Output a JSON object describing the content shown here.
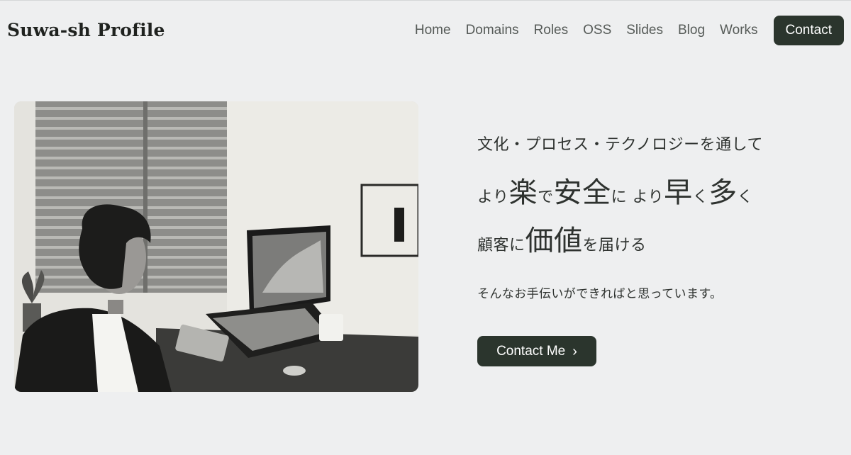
{
  "brand": {
    "title": "Suwa-sh Profile"
  },
  "nav": {
    "items": [
      {
        "label": "Home"
      },
      {
        "label": "Domains"
      },
      {
        "label": "Roles"
      },
      {
        "label": "OSS"
      },
      {
        "label": "Slides"
      },
      {
        "label": "Blog"
      },
      {
        "label": "Works"
      }
    ],
    "contact_label": "Contact"
  },
  "hero": {
    "line1": "文化・プロセス・テクノロジーを通して",
    "line2": {
      "p1": "より",
      "w1": "楽",
      "p2": "で",
      "w2": "安全",
      "p3": "に より",
      "w3": "早",
      "p4": "く",
      "w4": "多",
      "p5": "く"
    },
    "line3": {
      "p1": "顧客に",
      "w1": "価値",
      "p2": "を届ける"
    },
    "subtext": "そんなお手伝いができればと思っています。",
    "cta_label": "Contact Me",
    "cta_icon": "chevron-right-icon"
  },
  "colors": {
    "background": "#eeeff0",
    "accent": "#2b352d",
    "nav_text": "#555a57"
  }
}
